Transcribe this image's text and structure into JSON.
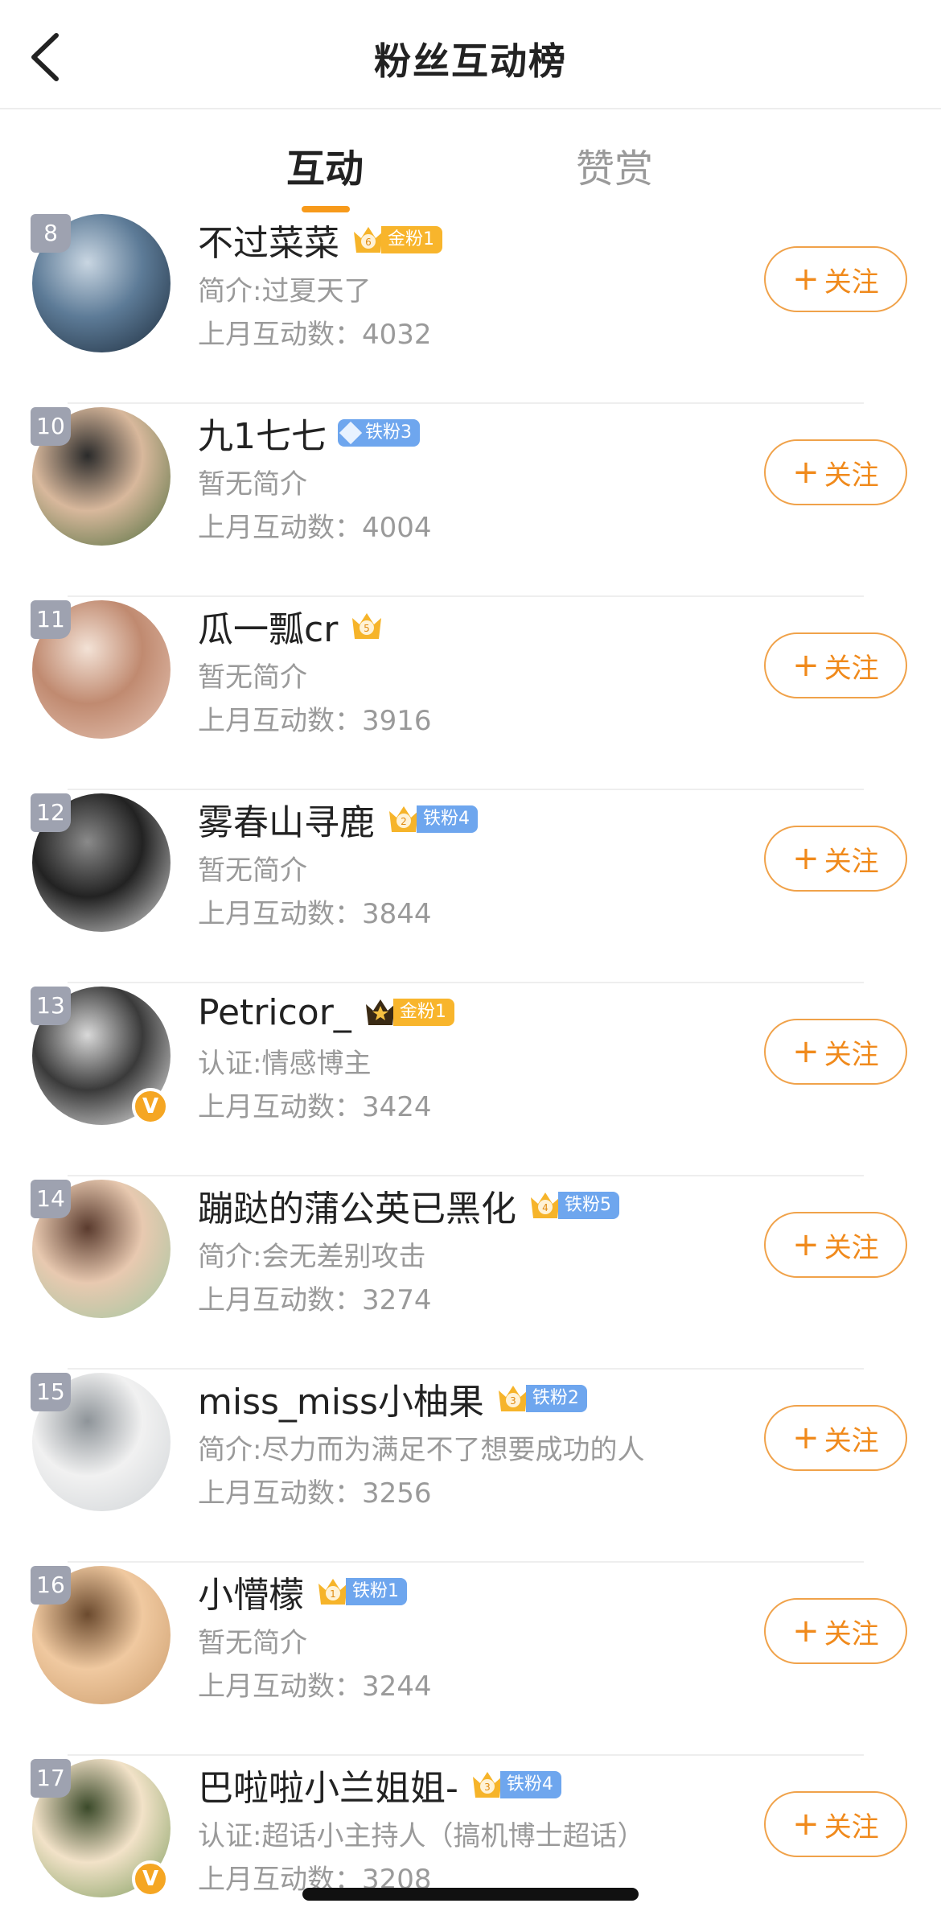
{
  "header": {
    "title": "粉丝互动榜",
    "back_icon": "chevron-left-icon"
  },
  "tabs": [
    {
      "label": "互动",
      "active": true
    },
    {
      "label": "赞赏",
      "active": false
    }
  ],
  "follow_label": "关注",
  "colors": {
    "accent": "#f79a1b",
    "follow": "#f08a1c",
    "gold_tag": "#f8b52c",
    "iron_tag": "#6ea6ee",
    "rank_badge": "#9ea2b0"
  },
  "fans": [
    {
      "rank": "8",
      "name": "不过菜菜",
      "crown_level": "6",
      "fan_tag": "金粉1",
      "tag_type": "gold",
      "bio": "简介:过夏天了",
      "count": "上月互动数：4032",
      "verified": false,
      "avatar_colors": [
        "#1b2a3a",
        "#5d7b97",
        "#c9d6e2"
      ]
    },
    {
      "rank": "10",
      "name": "九1七七",
      "crown_level": "",
      "fan_tag": "铁粉3",
      "tag_type": "iron-diamond",
      "bio": "暂无简介",
      "count": "上月互动数：4004",
      "verified": false,
      "avatar_colors": [
        "#4a6b3a",
        "#d8b89c",
        "#2a2a2a"
      ]
    },
    {
      "rank": "11",
      "name": "瓜一瓢cr",
      "crown_level": "5",
      "fan_tag": "",
      "tag_type": "none",
      "bio": "暂无简介",
      "count": "上月互动数：3916",
      "verified": false,
      "avatar_colors": [
        "#e8c8b8",
        "#c08a70",
        "#f3e2d6"
      ]
    },
    {
      "rank": "12",
      "name": "雾春山寻鹿",
      "crown_level": "2",
      "fan_tag": "铁粉4",
      "tag_type": "iron",
      "bio": "暂无简介",
      "count": "上月互动数：3844",
      "verified": false,
      "avatar_colors": [
        "#e0e0e0",
        "#222222",
        "#8a8a8a"
      ]
    },
    {
      "rank": "13",
      "name": "Petricor_",
      "crown_level": "star",
      "fan_tag": "金粉1",
      "tag_type": "gold",
      "bio": "认证:情感博主",
      "count": "上月互动数：3424",
      "verified": true,
      "avatar_colors": [
        "#f4f4f4",
        "#3a3a3a",
        "#d9d9d9"
      ]
    },
    {
      "rank": "14",
      "name": "蹦跶的蒲公英已黑化",
      "crown_level": "4",
      "fan_tag": "铁粉5",
      "tag_type": "iron",
      "bio": "简介:会无差别攻击",
      "count": "上月互动数：3274",
      "verified": false,
      "avatar_colors": [
        "#9fc7a0",
        "#e8c9b0",
        "#5a3b2e"
      ]
    },
    {
      "rank": "15",
      "name": "miss_miss小柚果",
      "crown_level": "3",
      "fan_tag": "铁粉2",
      "tag_type": "iron",
      "bio": "简介:尽力而为满足不了想要成功的人",
      "count": "上月互动数：3256",
      "verified": false,
      "avatar_colors": [
        "#cfd3d6",
        "#f1f1f1",
        "#8e9499"
      ]
    },
    {
      "rank": "16",
      "name": "小懵檬",
      "crown_level": "1",
      "fan_tag": "铁粉1",
      "tag_type": "iron",
      "bio": "暂无简介",
      "count": "上月互动数：3244",
      "verified": false,
      "avatar_colors": [
        "#c99a6a",
        "#f0c9a0",
        "#6b4a2e"
      ]
    },
    {
      "rank": "17",
      "name": "巴啦啦小兰姐姐-",
      "crown_level": "3",
      "fan_tag": "铁粉4",
      "tag_type": "iron",
      "bio": "认证:超话小主持人（搞机博士超话）",
      "count": "上月互动数：3208",
      "verified": true,
      "avatar_colors": [
        "#7a9a5a",
        "#f2e2c8",
        "#3b4a2a"
      ]
    }
  ]
}
